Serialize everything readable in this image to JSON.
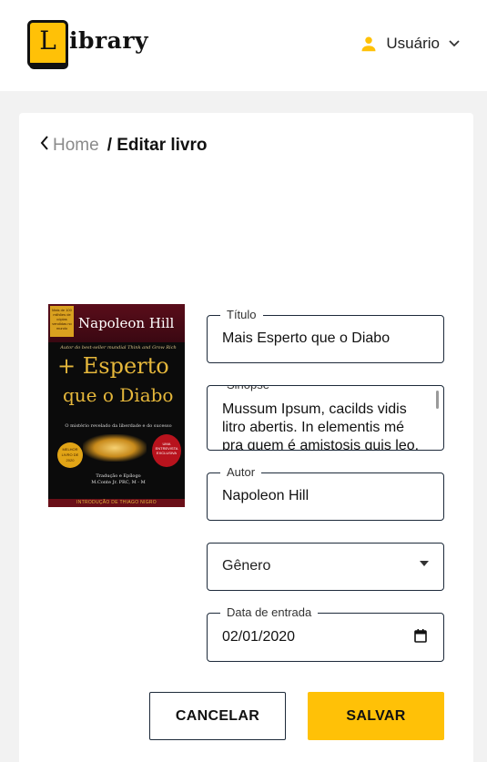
{
  "header": {
    "logo_letter": "L",
    "logo_text": "ibrary",
    "user_label": "Usuário"
  },
  "breadcrumb": {
    "home": "Home",
    "separator": "/",
    "current": "Editar livro"
  },
  "book_cover": {
    "author": "Napoleon Hill",
    "title_line1": "+ Esperto",
    "title_line2": "que o Diabo",
    "subtitle": "O mistério revelado da liberdade e do sucesso",
    "translation": "Tradução e Epílogo",
    "translator": "M.Conte Jr. PRC, M - M",
    "intro": "INTRODUÇÃO DE THIAGO NIGRO"
  },
  "form": {
    "titulo": {
      "label": "Título",
      "value": "Mais Esperto que o Diabo"
    },
    "sinopse": {
      "label": "Sinopse",
      "value": "Mussum Ipsum, cacilds vidis litro abertis. In elementis mé pra quem é amistosis quis leo."
    },
    "autor": {
      "label": "Autor",
      "value": "Napoleon Hill"
    },
    "genero": {
      "placeholder": "Gênero"
    },
    "data_entrada": {
      "label": "Data de entrada",
      "value": "02/01/2020"
    }
  },
  "actions": {
    "cancel": "CANCELAR",
    "save": "SALVAR"
  },
  "colors": {
    "accent": "#ffc107",
    "border": "#1d2a3a",
    "background": "#f2f2f2",
    "muted_text": "#8a8a8a"
  },
  "icons": [
    "logo-book-icon",
    "user-icon",
    "chevron-down-icon",
    "chevron-left-icon",
    "dropdown-arrow-icon",
    "calendar-icon"
  ]
}
